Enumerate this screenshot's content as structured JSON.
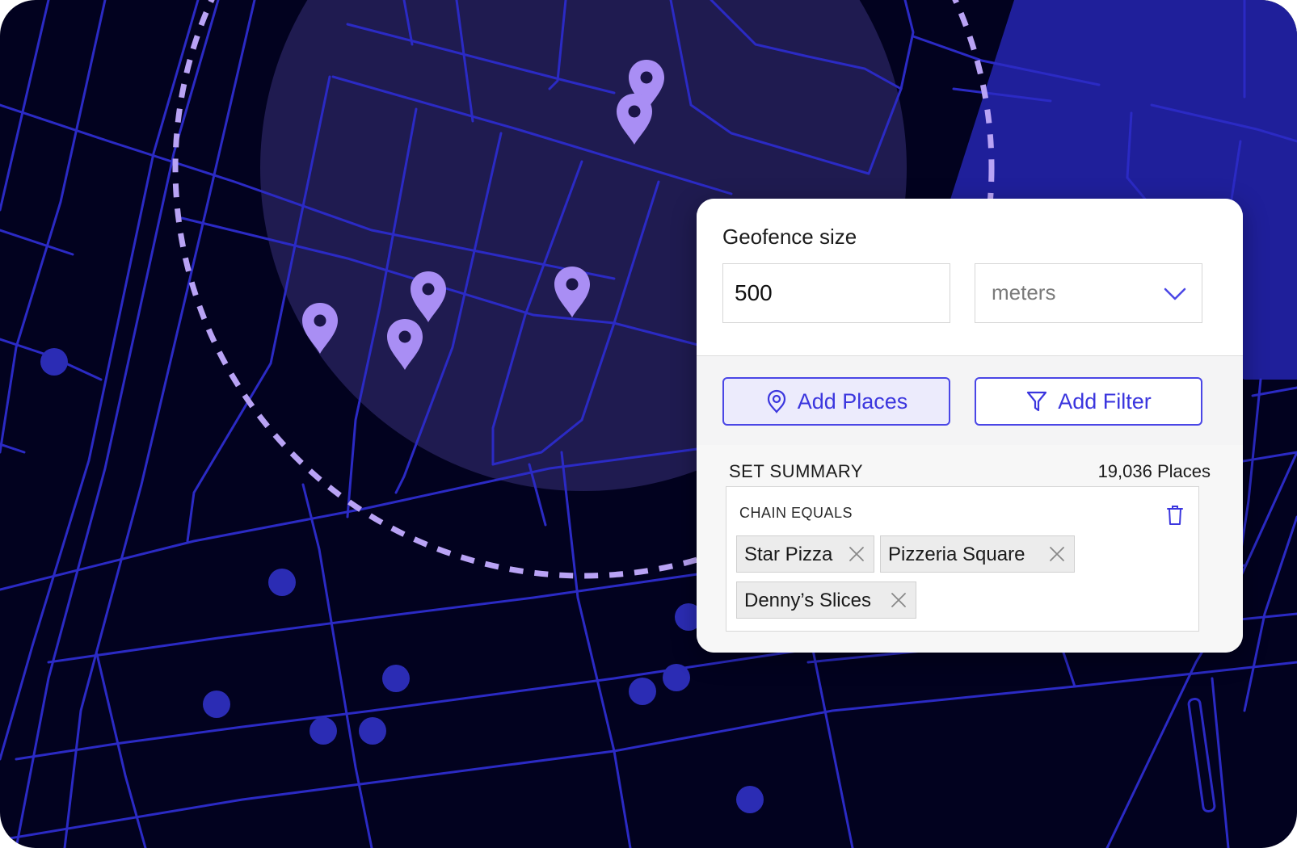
{
  "panel": {
    "geofence_label": "Geofence size",
    "size_value": "500",
    "unit_value": "meters",
    "add_places_label": "Add Places",
    "add_filter_label": "Add Filter",
    "summary_title": "SET SUMMARY",
    "summary_count": "19,036 Places",
    "filter_label": "CHAIN EQUALS",
    "chips": [
      "Star Pizza",
      "Pizzeria Square",
      "Denny’s Slices"
    ]
  },
  "colors": {
    "map_background": "#02021f",
    "street_line": "#2b2ac4",
    "geofence_circle": "#b9a3f5",
    "pin": "#a98ef4",
    "accent": "#4a46e6"
  },
  "icons": {
    "chevron": "chevron-down-icon",
    "pin": "map-pin-icon",
    "filter": "filter-icon",
    "trash": "trash-icon",
    "close": "close-icon"
  }
}
